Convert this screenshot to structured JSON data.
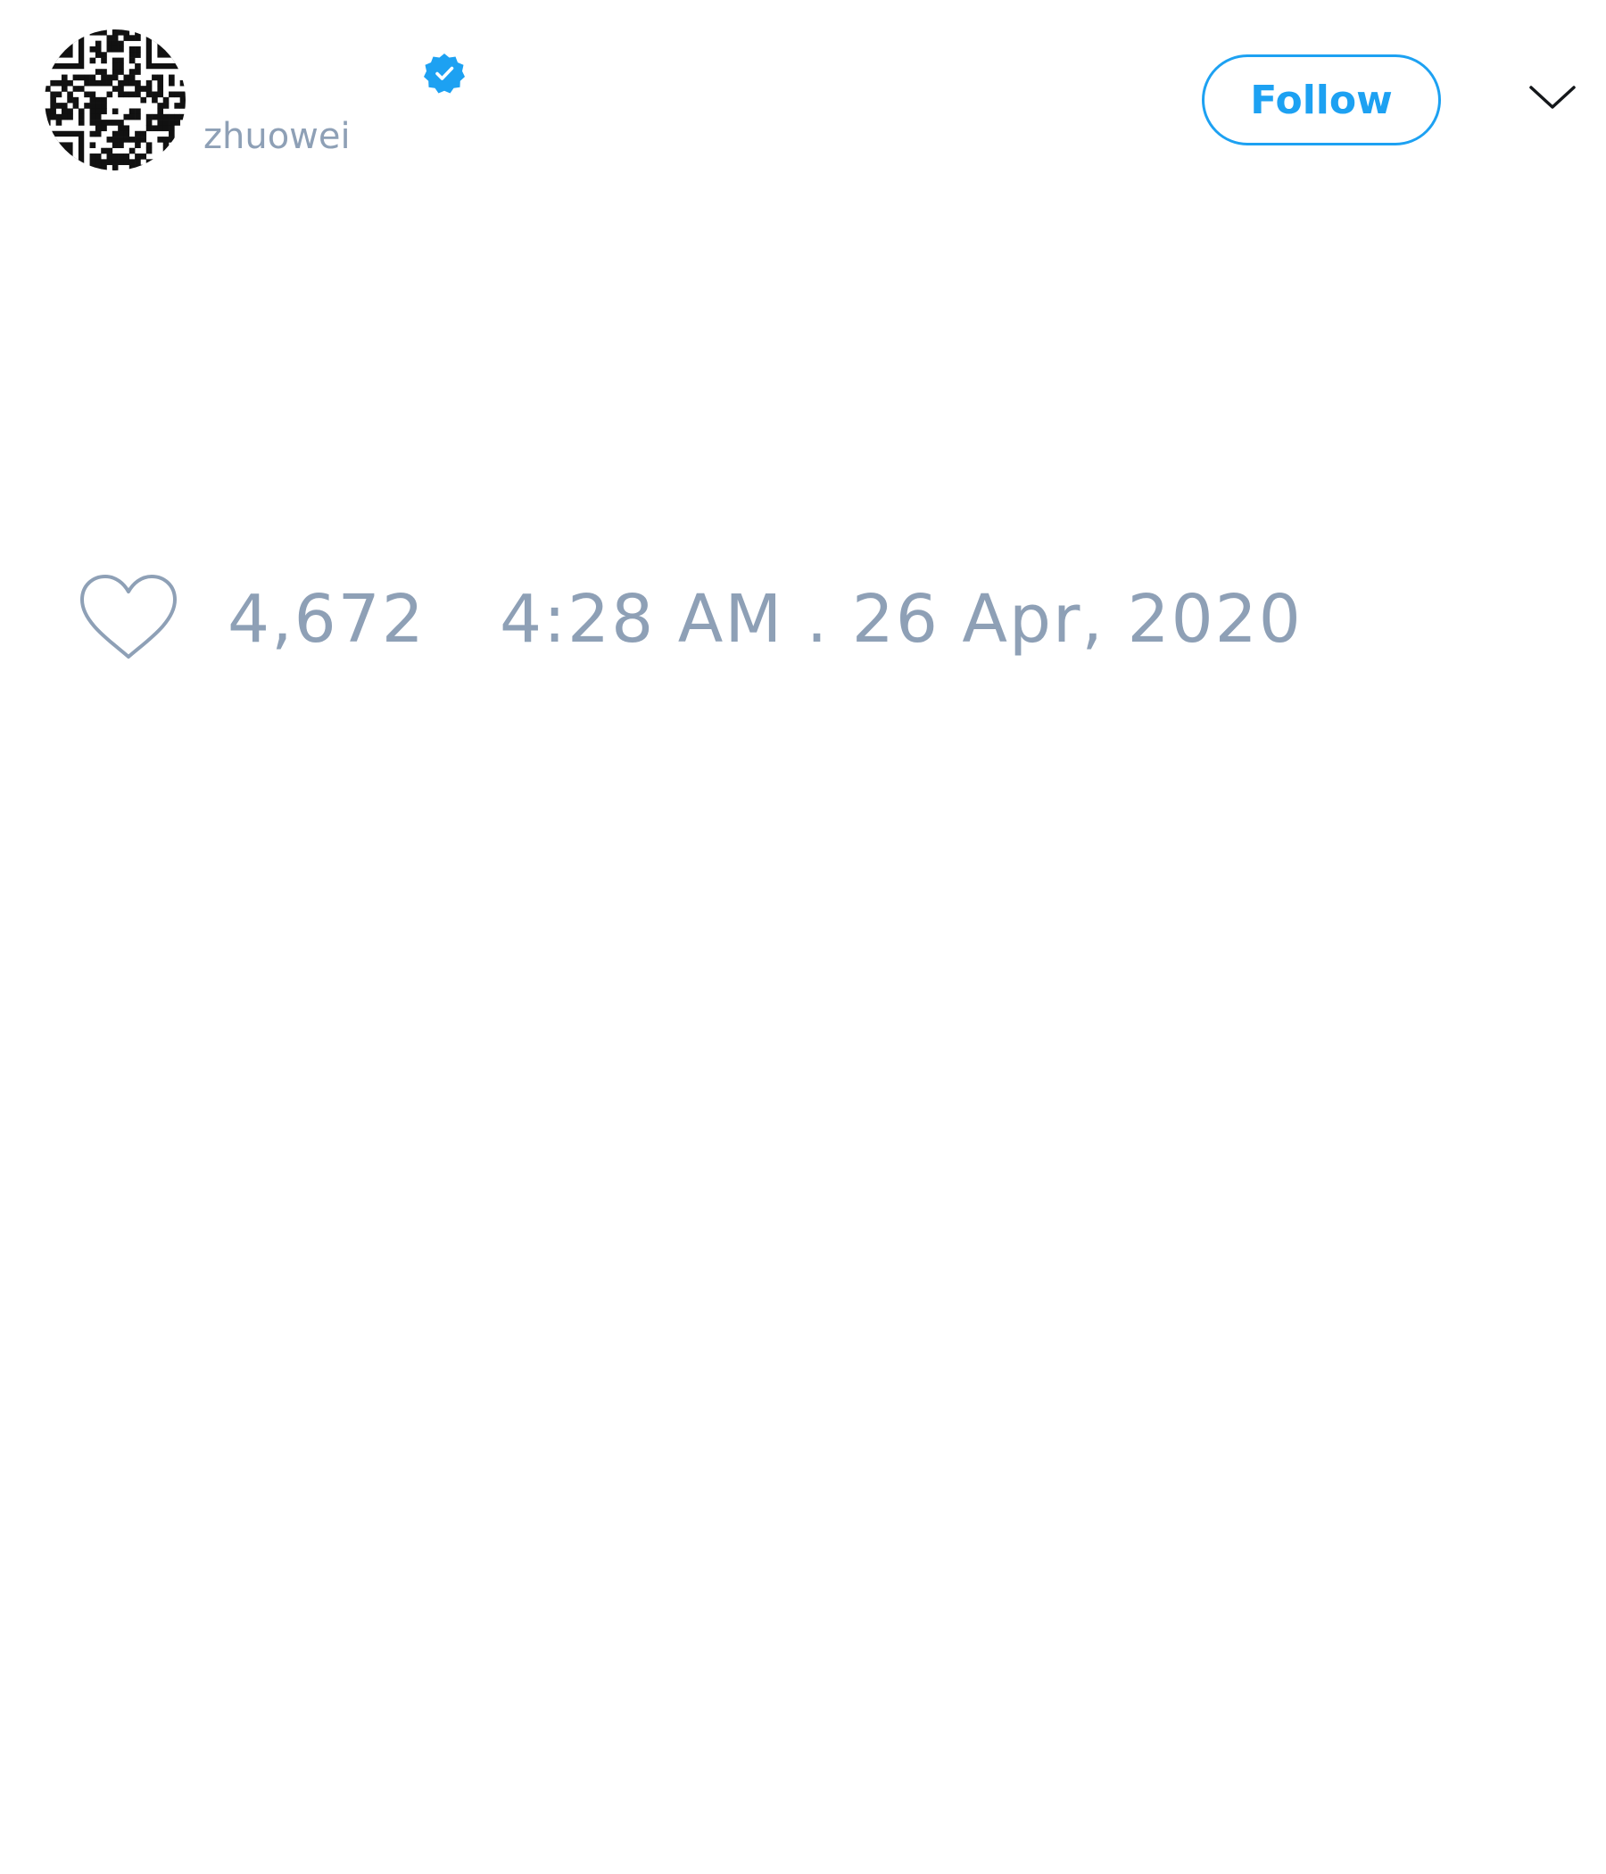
{
  "tweet": {
    "author": {
      "display_name": "",
      "username": "zhuowei",
      "verified": true,
      "avatar_icon": "qr-code-avatar"
    },
    "follow_label": "Follow",
    "menu_icon": "chevron-down-icon",
    "like_icon": "heart-icon",
    "like_count": "4,672",
    "timestamp": "4:28 AM . 26 Apr, 2020"
  },
  "colors": {
    "accent": "#1da1f2",
    "muted_text": "#8ea0b6",
    "background": "#ffffff"
  }
}
